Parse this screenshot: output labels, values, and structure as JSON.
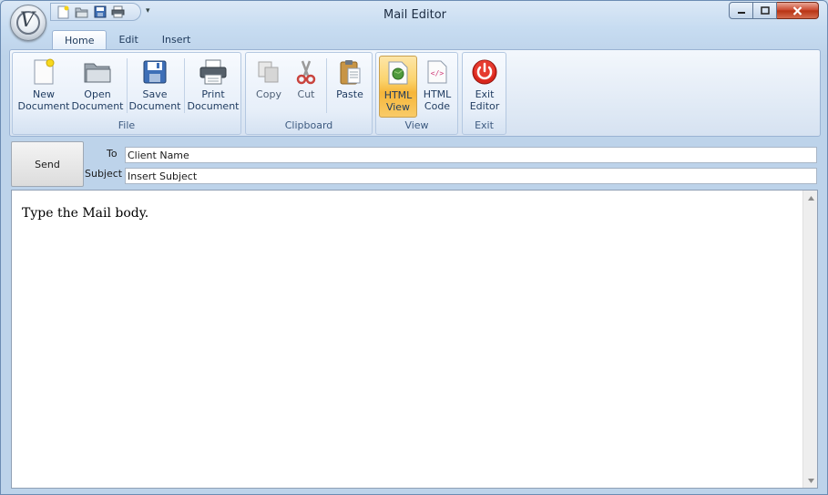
{
  "window": {
    "title": "Mail Editor"
  },
  "ribbon": {
    "tabs": [
      {
        "label": "Home",
        "active": true
      },
      {
        "label": "Edit",
        "active": false
      },
      {
        "label": "Insert",
        "active": false
      }
    ],
    "groups": {
      "file": {
        "label": "File",
        "buttons": [
          {
            "line1": "New",
            "line2": "Document",
            "icon": "new-document-icon"
          },
          {
            "line1": "Open",
            "line2": "Document",
            "icon": "open-folder-icon"
          },
          {
            "line1": "Save",
            "line2": "Document",
            "icon": "save-disk-icon"
          },
          {
            "line1": "Print",
            "line2": "Document",
            "icon": "printer-icon"
          }
        ]
      },
      "clipboard": {
        "label": "Clipboard",
        "buttons": [
          {
            "line1": "Copy",
            "icon": "copy-icon",
            "enabled": false
          },
          {
            "line1": "Cut",
            "icon": "scissors-icon",
            "enabled": false
          },
          {
            "line1": "Paste",
            "icon": "clipboard-paste-icon",
            "enabled": true
          }
        ]
      },
      "view": {
        "label": "View",
        "buttons": [
          {
            "line1": "HTML",
            "line2": "View",
            "icon": "globe-page-icon",
            "active": true
          },
          {
            "line1": "HTML",
            "line2": "Code",
            "icon": "code-page-icon",
            "active": false
          }
        ]
      },
      "exit": {
        "label": "Exit",
        "buttons": [
          {
            "line1": "Exit",
            "line2": "Editor",
            "icon": "power-icon"
          }
        ]
      }
    }
  },
  "compose": {
    "send_label": "Send",
    "to_label": "To",
    "subject_label": "Subject",
    "to_value": "Client Name",
    "subject_value": "Insert Subject",
    "body_text": "Type the Mail body."
  },
  "colors": {
    "accent_active": "#f6b63a",
    "frame": "#c9dcef",
    "close_button": "#c9442a"
  }
}
